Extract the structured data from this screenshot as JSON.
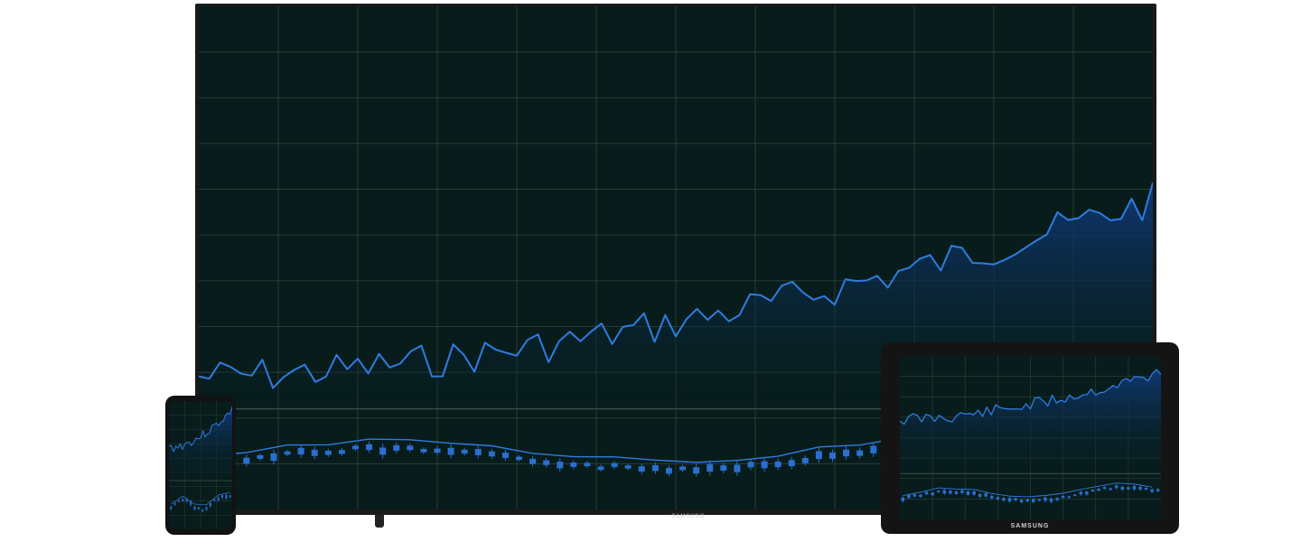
{
  "brand": {
    "tv_logo": "SAMSUNG",
    "tablet_logo": "SAMSUNG"
  },
  "colors": {
    "screen_bg": "#071c1b",
    "grid": "#2a3d3a",
    "line": "#2f7ce0",
    "area_top": "#0f3a78",
    "candle": "#2a6fd0"
  }
}
